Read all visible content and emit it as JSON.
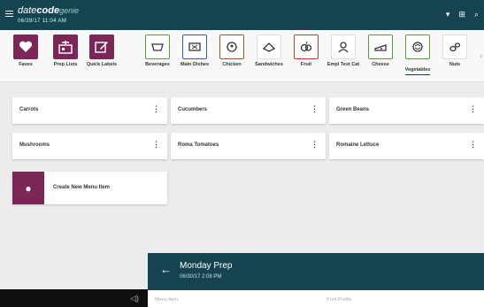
{
  "header": {
    "brand_light": "date",
    "brand_bold": "code",
    "brand_tail": "genie",
    "timestamp": "06/29/17  11:04 AM"
  },
  "categories": [
    {
      "label": "Faves",
      "icon": "heart-icon",
      "type": "main"
    },
    {
      "label": "Prep Lists",
      "icon": "kitchen-icon",
      "type": "main"
    },
    {
      "label": "Quick Labels",
      "icon": "edit-icon",
      "type": "main"
    },
    {
      "label": "Beverages",
      "icon": "beverage-icon",
      "type": "food",
      "color": "#5a9a3a"
    },
    {
      "label": "Main Dishes",
      "icon": "main-dish-icon",
      "type": "food",
      "color": "#3a5aa8"
    },
    {
      "label": "Chicken",
      "icon": "chicken-icon",
      "type": "food",
      "color": "#a0522d"
    },
    {
      "label": "Sandwiches",
      "icon": "sandwich-icon",
      "type": "food",
      "color": "#dddddd"
    },
    {
      "label": "Fruit",
      "icon": "fruit-icon",
      "type": "food",
      "color": "#c0392b"
    },
    {
      "label": "Empl Test Cat",
      "icon": "employee-icon",
      "type": "food",
      "color": "#dddddd"
    },
    {
      "label": "Cheese",
      "icon": "cheese-icon",
      "type": "food",
      "color": "#5a9a3a"
    },
    {
      "label": "Vegetables",
      "icon": "vegetable-icon",
      "type": "food",
      "color": "#5a9a3a",
      "active": true
    },
    {
      "label": "Nuts",
      "icon": "nut-icon",
      "type": "food",
      "color": "#dddddd"
    }
  ],
  "menu_items": [
    "Carrots",
    "Cucumbers",
    "Green Beans",
    "Mushrooms",
    "Roma Tomatoes",
    "Romaine Lettuce"
  ],
  "create_button": "Create New Menu Item",
  "prep_sheet": {
    "title": "Monday Prep",
    "date": "06/30/17   2:08 PM",
    "col_menu_item": "Menu Item",
    "col_print_profile": "Print Profile"
  },
  "colors": {
    "brand": "#154450",
    "accent": "#7a2757"
  }
}
